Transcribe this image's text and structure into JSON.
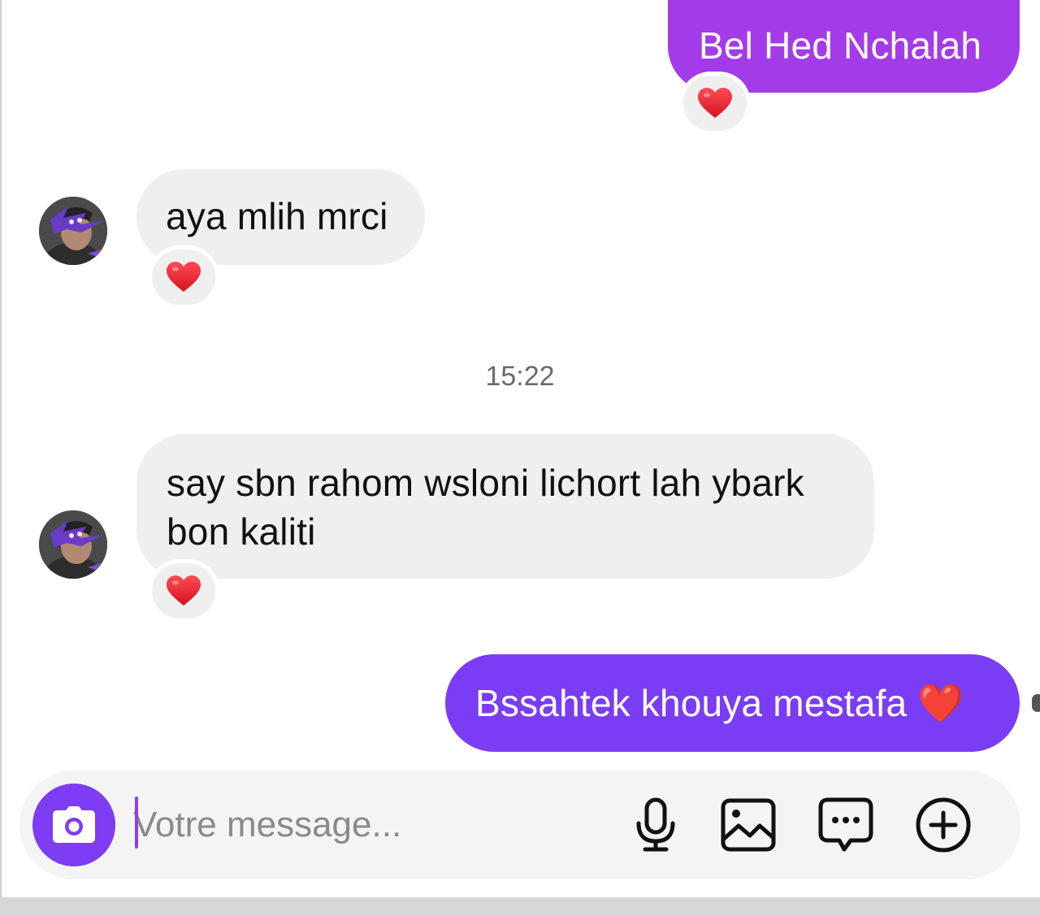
{
  "conversation": {
    "messages": [
      {
        "direction": "outgoing",
        "text": "Bel Hed Nchalah",
        "reaction": "heart"
      },
      {
        "direction": "incoming",
        "text": "aya mlih mrci",
        "reaction": "heart"
      },
      {
        "direction": "incoming",
        "text": "say sbn rahom wsloni lichort lah ybark bon kaliti",
        "reaction": "heart"
      },
      {
        "direction": "outgoing",
        "text": "Bssahtek khouya mestafa ❤️"
      }
    ],
    "timestamp": "15:22"
  },
  "composer": {
    "placeholder": "Votre message...",
    "value": "",
    "icons": [
      "camera-icon",
      "microphone-icon",
      "image-icon",
      "sticker-chat-icon",
      "plus-circle-icon"
    ]
  },
  "colors": {
    "outgoing_gradient_top": "#a23ae8",
    "outgoing_gradient_bottom": "#7a3df5",
    "incoming_bubble": "#efefef",
    "accent": "#7e3cf4",
    "heart": "#e8222f"
  }
}
